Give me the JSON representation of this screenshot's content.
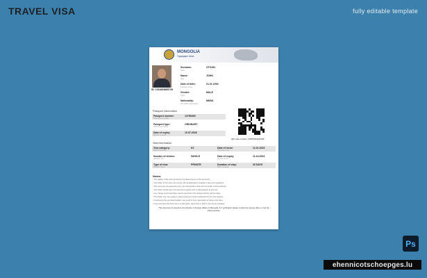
{
  "page": {
    "title": "TRAVEL VISA",
    "subtitle": "fully editable template",
    "ps_badge": "Ps",
    "watermark": "ehennicotschoepges.lu"
  },
  "visa": {
    "country": "MONGOLIA",
    "country_sub": "Гадаадын виза",
    "photo_id": "ID: 1231654865749",
    "personal": [
      {
        "label": "Surname:",
        "sub": "Овог",
        "value": "OTGON"
      },
      {
        "label": "Name:",
        "sub": "Нэр",
        "value": "JOHN"
      },
      {
        "label": "Date of birth:",
        "sub": "Төрсөн огноо",
        "value": "21.01.1994"
      },
      {
        "label": "Gender:",
        "sub": "Хүйс",
        "value": "MALE"
      },
      {
        "label": "Nationality:",
        "sub": "Иргэний харьяалал",
        "value": "MNNA"
      }
    ],
    "passport_section_title": "Passport information",
    "passport": [
      {
        "label": "Passport number:",
        "sub": "Паспортын дугаар",
        "value": "12785439"
      },
      {
        "label": "Passport type:",
        "sub": "Паспортын төрөл",
        "value": "ORDINARY"
      },
      {
        "label": "Date of expiry:",
        "sub": "Дуусах хугацаа",
        "value": "10.07.2028"
      }
    ],
    "qr_caption": "QR code number: 0987654321MNF",
    "visa_section_title": "Visa information",
    "visa_rows": [
      {
        "label": "Visa category:",
        "sub": "Визний ангилал",
        "value": "K2",
        "label2": "Date of issue:",
        "sub2": "Олгосон огноо",
        "value2": "11.01.2023"
      },
      {
        "label": "Number of entries:",
        "sub": "Нэвтрэх тоо",
        "value": "SINGLE",
        "label2": "Date of expiry:",
        "sub2": "Дуусах огноо",
        "value2": "11.04.2023"
      },
      {
        "label": "Type of visa:",
        "sub": "Визний төрөл",
        "value": "PRIVATE",
        "label2": "Duration of stay:",
        "sub2": "Байх хугацаа",
        "value2": "30 DAYS"
      }
    ],
    "notes_title": "Notes:",
    "notes": [
      "• The validity of this visa is limited by the dates shown on this document.",
      "• The holder of this visa must comply with all applicable immigration rules and regulations.",
      "• This visa does not guarantee entry; the final decision rests with the border control authority.",
      "• The holder should carry this document together with a valid passport at all times.",
      "• Any change of personal data must be reported to the issuing authority without delay.",
      "• The holder may not engage in paid employment unless authorized by the visa category.",
      "• Overstaying the permitted duration may result in fines, deportation or future entry bans.",
      "• Copy and keep this document in a safe place; report loss or theft to the nearest embassy."
    ],
    "footer": "This document is issued by the Ministry of Foreign Affairs of Mongolia. For verification please contact the issuing office or visit the official website."
  },
  "colors": {
    "background": "#3c80ad",
    "document": "#ffffff",
    "row_shade": "#e4e4e4",
    "brand_blue": "#2a4a8a"
  }
}
